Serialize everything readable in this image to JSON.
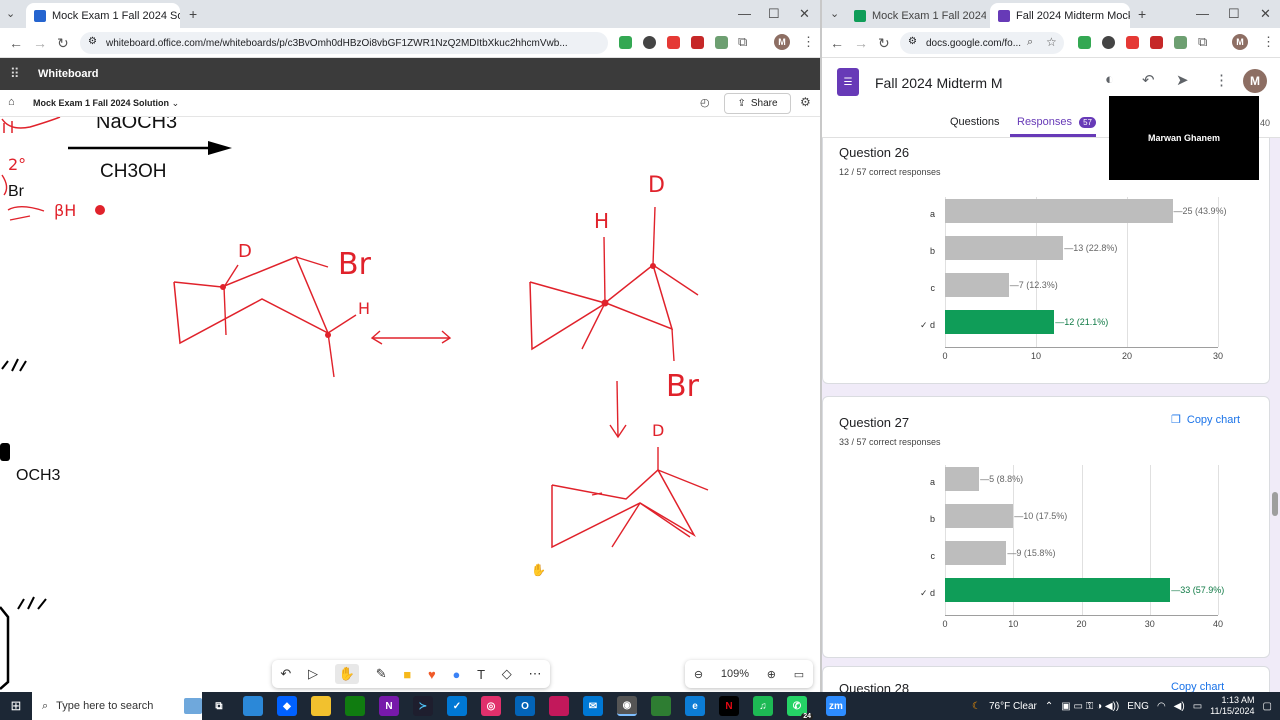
{
  "left_browser": {
    "tabs": [
      {
        "title": "Mock Exam 1 Fall 2024 Solutio",
        "active": true
      },
      {
        "title": "",
        "active": false
      }
    ],
    "new_tab": "+",
    "url": "whiteboard.office.com/me/whiteboards/p/c3BvOmh0dHBzOi8vbGF1ZWR1NzQ2MDItbXkuc2hhcmVwb...",
    "profile_initial": "M"
  },
  "whiteboard": {
    "app_name": "Whiteboard",
    "board_title": "Mock Exam 1 Fall 2024 Solution",
    "share_label": "Share",
    "zoom": "109%",
    "canvas_text": {
      "reagent_top": "NaOCH3",
      "reagent_bottom": "CH3OH",
      "br_left": "Br",
      "degree": "2°",
      "bh": "βH",
      "och3": "OCH3",
      "d1": "D",
      "br1": "Br",
      "h1": "H",
      "h2": "H",
      "d2": "D",
      "br2": "Br",
      "d3": "D"
    }
  },
  "right_browser": {
    "tabs": [
      {
        "title": "Mock Exam 1 Fall 2024 - Go",
        "active": false
      },
      {
        "title": "Fall 2024 Midterm Mock Ex",
        "active": true
      }
    ],
    "url": "docs.google.com/fo...",
    "profile_initial": "M"
  },
  "forms": {
    "title": "Fall 2024 Midterm M",
    "tabs": {
      "questions": "Questions",
      "responses": "Responses",
      "responses_count": "57"
    },
    "video_name": "Marwan Ghanem",
    "video_side_number": "40",
    "questions": [
      {
        "title": "Question 26",
        "correct_text": "12 / 57 correct responses",
        "copy_chart": "",
        "chart_data": {
          "type": "bar",
          "orientation": "horizontal",
          "categories": [
            "a",
            "b",
            "c",
            "✓ d"
          ],
          "values": [
            25,
            13,
            7,
            12
          ],
          "labels": [
            "25 (43.9%)",
            "13 (22.8%)",
            "7 (12.3%)",
            "12 (21.1%)"
          ],
          "correct_index": 3,
          "xlim": [
            0,
            30
          ],
          "ticks": [
            "0",
            "10",
            "20",
            "30"
          ]
        }
      },
      {
        "title": "Question 27",
        "correct_text": "33 / 57 correct responses",
        "copy_chart": "Copy chart",
        "chart_data": {
          "type": "bar",
          "orientation": "horizontal",
          "categories": [
            "a",
            "b",
            "c",
            "✓ d"
          ],
          "values": [
            5,
            10,
            9,
            33
          ],
          "labels": [
            "5 (8.8%)",
            "10 (17.5%)",
            "9 (15.8%)",
            "33 (57.9%)"
          ],
          "correct_index": 3,
          "xlim": [
            0,
            40
          ],
          "ticks": [
            "0",
            "10",
            "20",
            "30",
            "40"
          ]
        }
      }
    ],
    "next_question_partial": "Question 28",
    "next_copy_partial": "Copy chart"
  },
  "taskbar": {
    "search_placeholder": "Type here to search",
    "weather": "76°F  Clear",
    "lang": "ENG",
    "time": "1:13 AM",
    "date": "11/15/2024",
    "notif_count": "24"
  },
  "colors": {
    "correct": "#0f9d58",
    "incorrect": "#bdbdbd",
    "forms_purple": "#673ab7",
    "ink_red": "#e0222b"
  }
}
